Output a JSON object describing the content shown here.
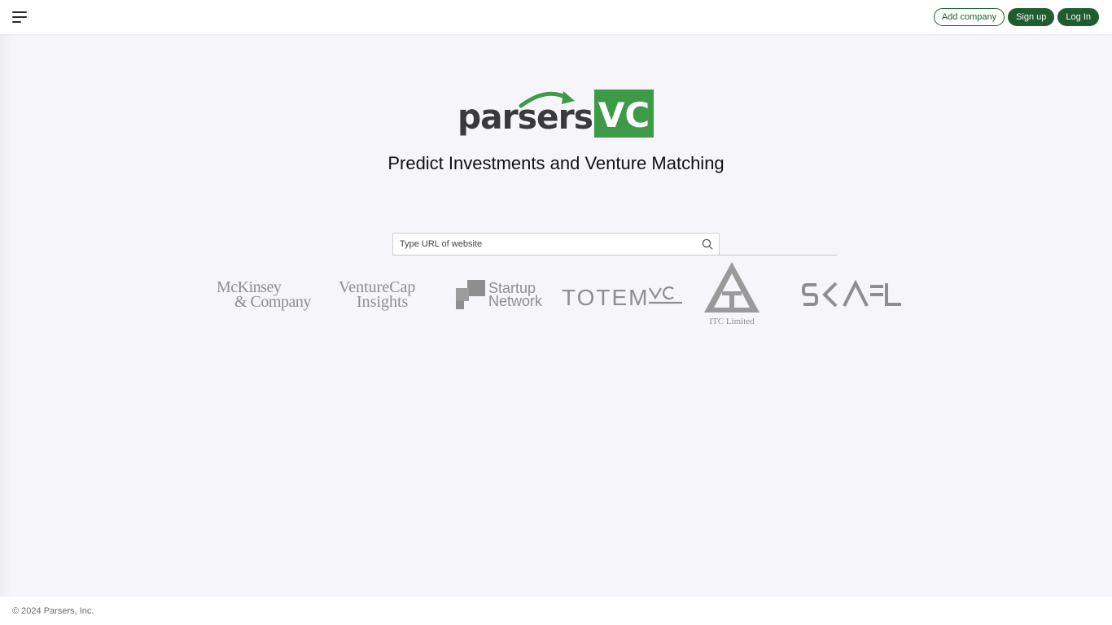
{
  "header": {
    "add_company_label": "Add company",
    "signup_label": "Sign up",
    "login_label": "Log In"
  },
  "brand": {
    "logo_left": "parsers",
    "logo_right": "VC",
    "dark_color": "#3a3a3a",
    "green_color": "#3d9a47"
  },
  "hero": {
    "headline": "Predict Investments and Venture Matching"
  },
  "search": {
    "placeholder": "Type URL of website",
    "value": ""
  },
  "partners": {
    "mckinsey_line1": "McKinsey",
    "mckinsey_line2": "& Company",
    "venturecap_line1": "VentureCap",
    "venturecap_line2": "Insights",
    "startup_line1": "Startup",
    "startup_line2": "Network",
    "totem": "TOTEM",
    "itc_caption": "ITC Limited"
  },
  "footer": {
    "copyright": "© 2024 Parsers, Inc."
  },
  "colors": {
    "accent": "#1f5d2e",
    "logo_gray": "#8e8e8e",
    "background": "#f6f6fa"
  }
}
